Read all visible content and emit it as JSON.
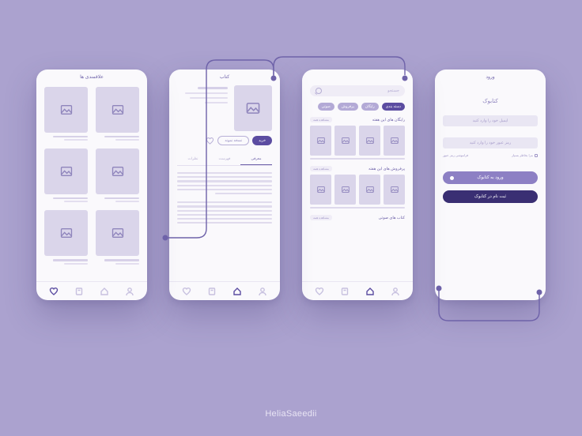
{
  "credit": "HeliaSaeedii",
  "login": {
    "header": "ورود",
    "brand": "کتابوک",
    "email_placeholder": "ایمیل خود را وارد کنید",
    "password_placeholder": "رمز عبور خود را وارد کنید",
    "remember_me": "مرا بخاطر بسپار",
    "forgot": "فراموشی رمز عبور",
    "login_button": "ورود به کتابوک",
    "signup_button": "ثبت نام در کتابوک"
  },
  "browse": {
    "search_placeholder": "جستجو",
    "chips": [
      "دسته بندی",
      "رایگان",
      "پرفروش",
      "صوتی"
    ],
    "chip_active_index": 0,
    "sections": [
      {
        "title": "رایگان های این هفته",
        "see_all": "مشاهده همه"
      },
      {
        "title": "پرفروش های این هفته",
        "see_all": "مشاهده همه"
      },
      {
        "title": "کتاب های صوتی",
        "see_all": "مشاهده همه"
      }
    ]
  },
  "detail": {
    "header": "کتاب",
    "buy": "خرید",
    "sample": "نسخه نمونه",
    "tabs": [
      "معرفی",
      "فهرست",
      "نظرات"
    ],
    "tab_active_index": 0
  },
  "favorites": {
    "header": "علاقمندی ها"
  },
  "tabbar": {
    "icons": [
      "profile",
      "home",
      "library",
      "favorites"
    ]
  }
}
